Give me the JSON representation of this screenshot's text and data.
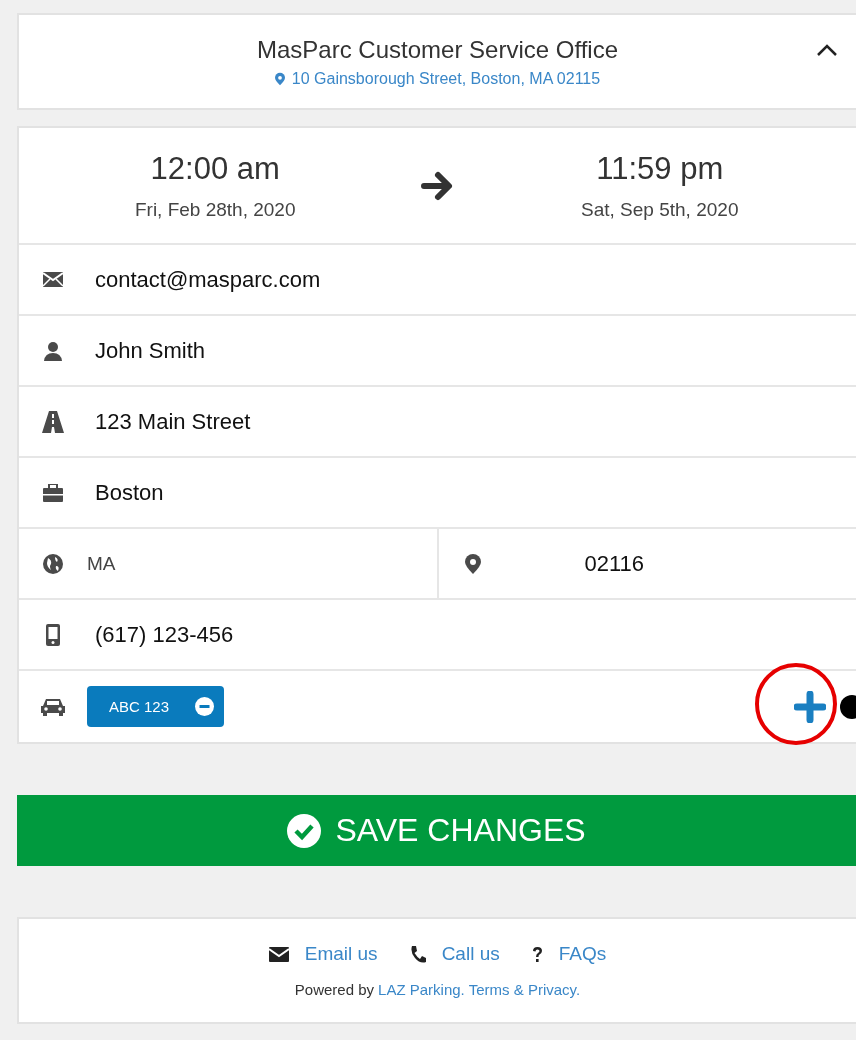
{
  "header": {
    "title": "MasParc Customer Service Office",
    "address": "10 Gainsborough Street, Boston, MA 02115"
  },
  "schedule": {
    "start": {
      "time": "12:00 am",
      "date": "Fri, Feb 28th, 2020"
    },
    "end": {
      "time": "11:59 pm",
      "date": "Sat, Sep 5th, 2020"
    }
  },
  "rows": [
    {
      "kind": "email",
      "value": "contact@masparc.com"
    },
    {
      "kind": "name",
      "value": "John Smith"
    },
    {
      "kind": "street",
      "value": "123 Main Street"
    },
    {
      "kind": "city",
      "value": "Boston"
    },
    {
      "kind": "region",
      "state": "MA",
      "zip": "02116"
    },
    {
      "kind": "phone",
      "value": "(617) 123-456"
    }
  ],
  "vehicles": [
    {
      "plate": "ABC 123"
    }
  ],
  "save_button": "SAVE CHANGES",
  "footer": {
    "links": [
      {
        "kind": "email",
        "label": "Email us"
      },
      {
        "kind": "call",
        "label": "Call us"
      },
      {
        "kind": "faq",
        "label": "FAQs"
      }
    ],
    "powered": "Powered by",
    "powered_links": [
      "LAZ Parking.",
      "Terms & Privacy."
    ]
  }
}
